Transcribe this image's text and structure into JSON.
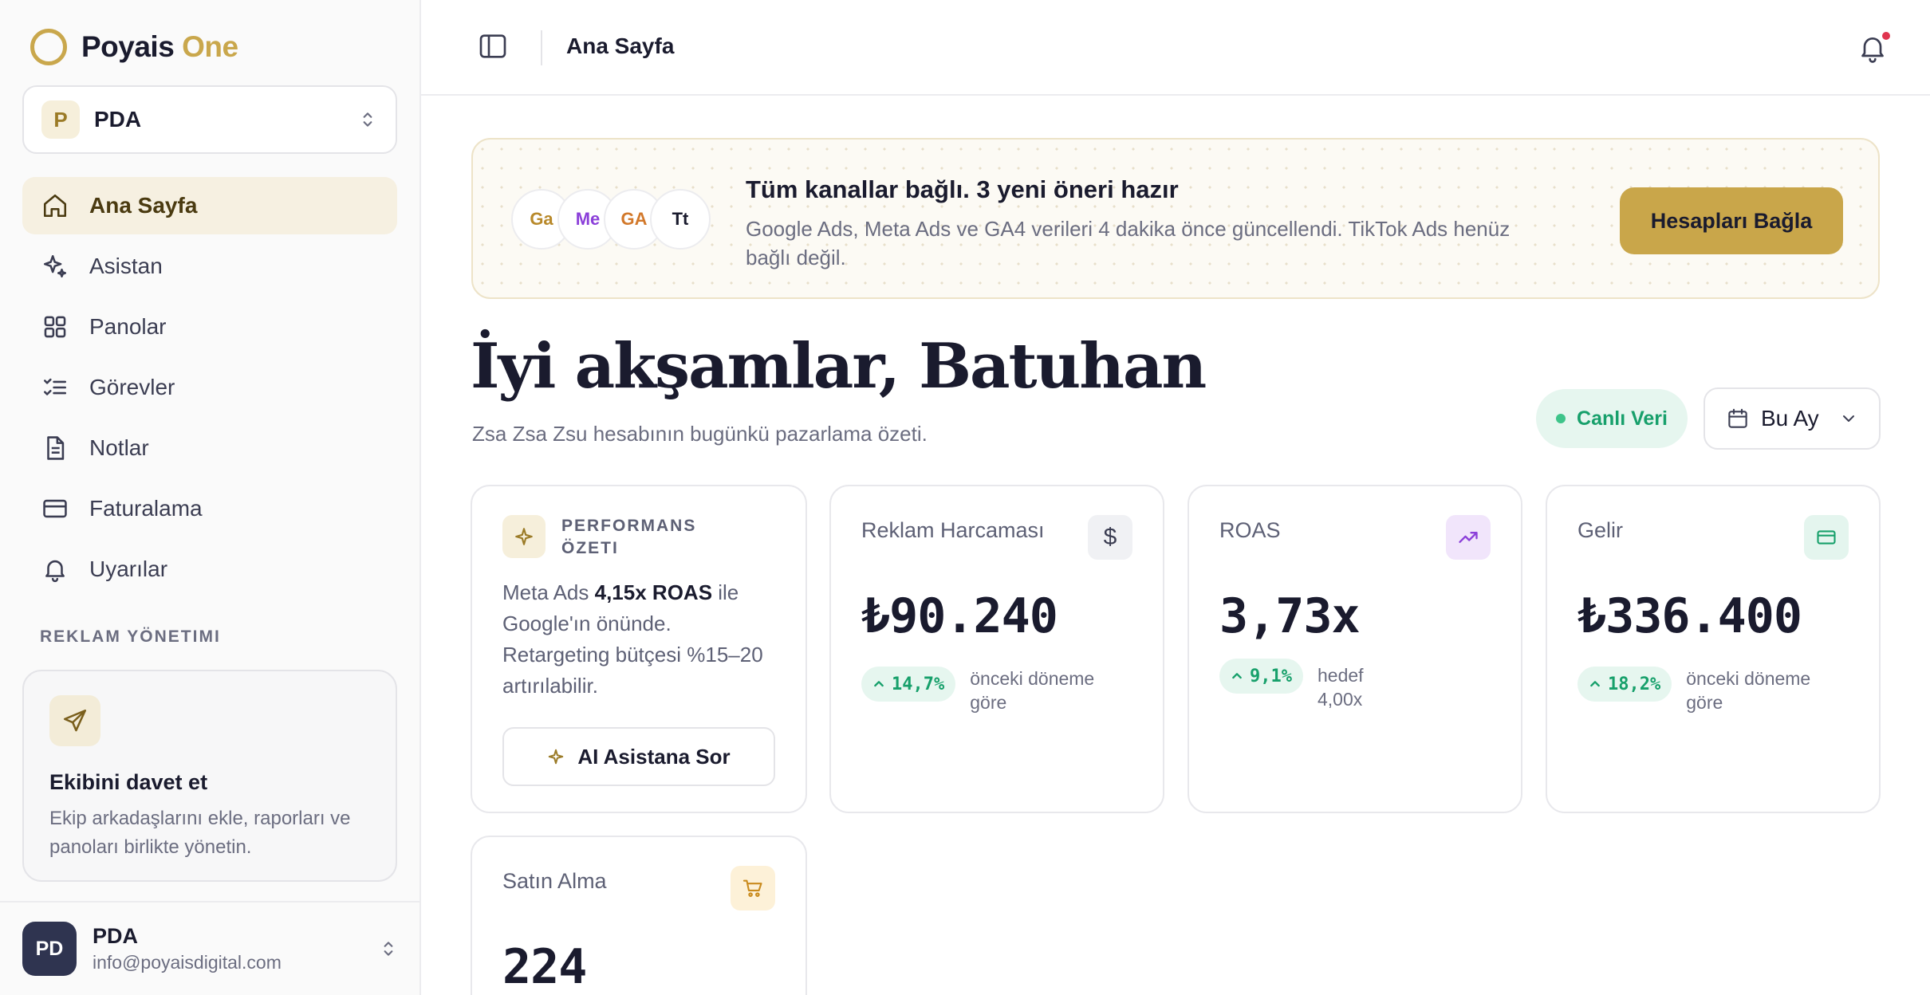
{
  "brand": {
    "name": "Poyais",
    "accent": "One",
    "color": "#c9a74c"
  },
  "workspace": {
    "badge": "P",
    "name": "PDA"
  },
  "nav": [
    {
      "label": "Ana Sayfa",
      "icon": "home-icon",
      "active": true
    },
    {
      "label": "Asistan",
      "icon": "sparkles-icon"
    },
    {
      "label": "Panolar",
      "icon": "grid-icon"
    },
    {
      "label": "Görevler",
      "icon": "checklist-icon"
    },
    {
      "label": "Notlar",
      "icon": "document-icon"
    },
    {
      "label": "Faturalama",
      "icon": "credit-card-icon"
    },
    {
      "label": "Uyarılar",
      "icon": "bell-icon"
    }
  ],
  "section_label": "REKLAM YÖNETIMI",
  "invite": {
    "title": "Ekibini davet et",
    "text": "Ekip arkadaşlarını ekle, raporları ve panoları birlikte yönetin."
  },
  "user": {
    "initials": "PD",
    "name": "PDA",
    "email": "info@poyaisdigital.com"
  },
  "header": {
    "title": "Ana Sayfa"
  },
  "banner": {
    "channels": [
      {
        "abbr": "Ga",
        "color": "#b8892a"
      },
      {
        "abbr": "Me",
        "color": "#8b3fd9"
      },
      {
        "abbr": "GA",
        "color": "#d2782a"
      },
      {
        "abbr": "Tt",
        "color": "#1a1b2e"
      }
    ],
    "title": "Tüm kanallar bağlı. 3 yeni öneri hazır",
    "text": "Google Ads, Meta Ads ve GA4 verileri 4 dakika önce güncellendi. TikTok Ads henüz bağlı değil.",
    "button": "Hesapları Bağla"
  },
  "greeting": "İyi akşamlar, Batuhan",
  "subtitle": "Zsa Zsa Zsu hesabının bugünkü pazarlama özeti.",
  "live_label": "Canlı Veri",
  "period": "Bu Ay",
  "summary": {
    "label": "PERFORMANS ÖZETI",
    "text_pre": "Meta Ads ",
    "text_bold": "4,15x ROAS",
    "text_post": " ile Google'ın önünde. Retargeting bütçesi %15–20 artırılabilir.",
    "button": "AI Asistana Sor"
  },
  "metrics": {
    "spend": {
      "title": "Reklam Harcaması",
      "value": "₺90.240",
      "change": "14,7%",
      "note": "önceki döneme göre",
      "icon": "dollar-icon"
    },
    "roas": {
      "title": "ROAS",
      "value": "3,73x",
      "change": "9,1%",
      "note": "hedef 4,00x",
      "icon": "trending-up-icon"
    },
    "revenue": {
      "title": "Gelir",
      "value": "₺336.400",
      "change": "18,2%",
      "note": "önceki döneme göre",
      "icon": "credit-card-icon"
    },
    "purchases": {
      "title": "Satın Alma",
      "value": "224",
      "icon": "cart-icon"
    }
  }
}
